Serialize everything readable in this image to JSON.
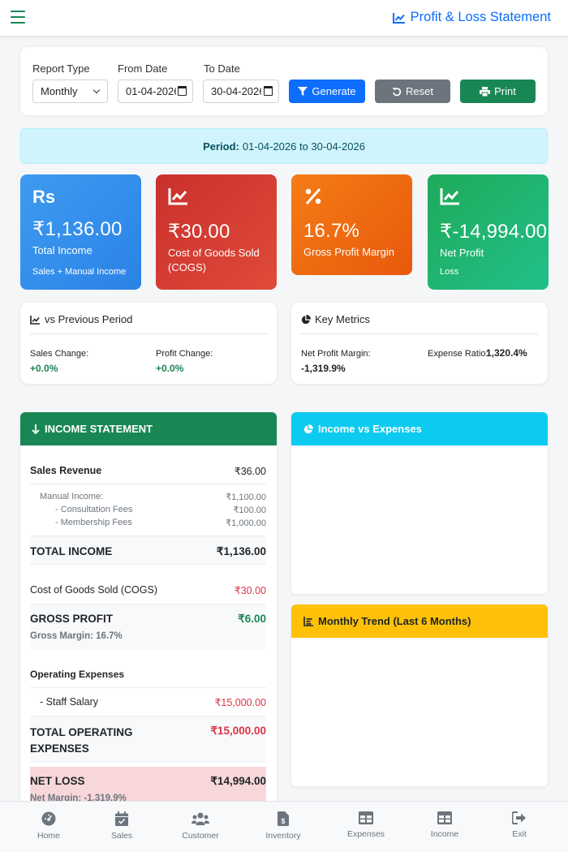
{
  "header": {
    "title": "Profit & Loss Statement"
  },
  "filters": {
    "report_type_label": "Report Type",
    "report_type_value": "Monthly",
    "from_label": "From Date",
    "from_value": "01-04-2026",
    "to_label": "To Date",
    "to_value": "30-04-2026",
    "generate": "Generate",
    "reset": "Reset",
    "print": "Print"
  },
  "period": {
    "label": "Period:",
    "value": "01-04-2026 to 30-04-2026"
  },
  "stats": [
    {
      "icon": "rupee-icon",
      "glyph": "Rs",
      "value": "₹1,136.00",
      "label": "Total Income",
      "sub": "Sales + Manual Income",
      "color": "#2f8ef0"
    },
    {
      "icon": "chart-line-icon",
      "value": "₹30.00",
      "label": "Cost of Goods Sold (COGS)",
      "sub": "",
      "color": "#d63a2f"
    },
    {
      "icon": "percent-icon",
      "value": "16.7%",
      "label": "Gross Profit Margin",
      "sub": "",
      "color": "#f26a10"
    },
    {
      "icon": "chart-line-icon",
      "value": "₹-14,994.00",
      "label": "Net Profit",
      "sub": "Loss",
      "color": "#1fb164"
    }
  ],
  "comparison": {
    "title": "vs Previous Period",
    "sales_change_label": "Sales Change:",
    "sales_change_value": "+0.0%",
    "profit_change_label": "Profit Change:",
    "profit_change_value": "+0.0%"
  },
  "key_metrics": {
    "title": "Key Metrics",
    "net_margin_label": "Net Profit Margin:",
    "net_margin_value": "-1,319.9%",
    "expense_ratio_label": "Expense Ratio:",
    "expense_ratio_value": "1,320.4%"
  },
  "income_statement": {
    "title": "INCOME STATEMENT",
    "sales_revenue_label": "Sales Revenue",
    "sales_revenue_value": "₹36.00",
    "manual_income_label": "Manual Income:",
    "manual_income_value": "₹1,100.00",
    "consultation_label": "- Consultation Fees",
    "consultation_value": "₹100.00",
    "membership_label": "- Membership Fees",
    "membership_value": "₹1,000.00",
    "total_income_label": "TOTAL INCOME",
    "total_income_value": "₹1,136.00",
    "cogs_label": "Cost of Goods Sold (COGS)",
    "cogs_value": "₹30.00",
    "gross_profit_label": "GROSS PROFIT",
    "gross_profit_value": "₹6.00",
    "gross_margin_text": "Gross Margin: 16.7%",
    "opex_label": "Operating Expenses",
    "staff_salary_label": "- Staff Salary",
    "staff_salary_value": "₹15,000.00",
    "total_opex_label": "TOTAL OPERATING EXPENSES",
    "total_opex_value": "₹15,000.00",
    "net_loss_label": "NET LOSS",
    "net_loss_value": "₹14,994.00",
    "net_margin_text": "Net Margin: -1,319.9%"
  },
  "charts": {
    "income_vs_expenses": "Income vs Expenses",
    "monthly_trend": "Monthly Trend (Last 6 Months)"
  },
  "nav": [
    {
      "label": "Home",
      "icon": "gauge-icon"
    },
    {
      "label": "Sales",
      "icon": "calendar-check-icon"
    },
    {
      "label": "Customer",
      "icon": "users-icon"
    },
    {
      "label": "Inventory",
      "icon": "invoice-icon"
    },
    {
      "label": "Expenses",
      "icon": "table-icon"
    },
    {
      "label": "Income",
      "icon": "table-icon"
    },
    {
      "label": "Exit",
      "icon": "sign-out-icon"
    }
  ],
  "colors": {
    "primary": "#0d6efd",
    "success": "#198754",
    "danger": "#dc3545",
    "info": "#0dcaf0",
    "warning": "#ffc107"
  }
}
